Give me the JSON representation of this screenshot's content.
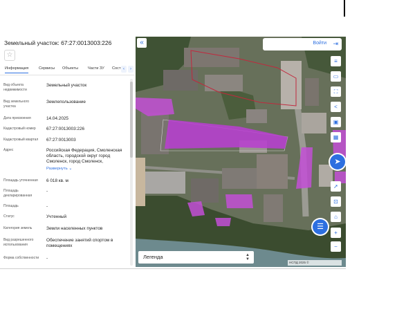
{
  "panel": {
    "title": "Земельный участок: 67:27:0013003:226",
    "star_icon": "star-icon",
    "tabs": [
      "Информация",
      "Сервисы",
      "Объекты",
      "Части ЗУ",
      "Сост"
    ],
    "fields": [
      {
        "label": "Вид объекта недвижимости",
        "value": "Земельный участок"
      },
      {
        "label": "Вид земельного участка",
        "value": "Землепользование"
      },
      {
        "label": "Дата присвоения",
        "value": "14.04.2025"
      },
      {
        "label": "Кадастровый номер",
        "value": "67:27:0013003:226"
      },
      {
        "label": "Кадастровый квартал",
        "value": "67:27:0013003"
      },
      {
        "label": "Адрес",
        "value": "Российская Федерация, Смоленская область, городской округ город Смоленск, город Смоленск,"
      },
      {
        "label": "Площадь уточненная",
        "value": "6 018 кв. м"
      },
      {
        "label": "Площадь декларированная",
        "value": "-"
      },
      {
        "label": "Площадь",
        "value": "-"
      },
      {
        "label": "Статус",
        "value": "Учтенный"
      },
      {
        "label": "Категория земель",
        "value": "Земли населенных пунктов"
      },
      {
        "label": "Вид разрешенного использования",
        "value": "Обеспечение занятий спортом в помещениях"
      },
      {
        "label": "Форма собственности",
        "value": "-"
      }
    ],
    "expand_link": "Развернуть"
  },
  "map": {
    "login_label": "Войти",
    "legend_label": "Легенда",
    "scale_text": "НСПД 2025 ©",
    "parcel_color": "#c34fd6",
    "icons": [
      "layers-icon",
      "measure-icon",
      "share-icon",
      "print-icon",
      "search-object-icon",
      "navigate-icon",
      "locate-icon",
      "zoom-in-icon",
      "zoom-out-icon",
      "chat-icon"
    ]
  }
}
